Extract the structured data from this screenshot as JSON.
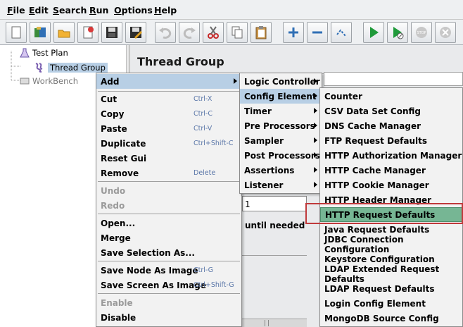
{
  "menubar": {
    "items": [
      {
        "label": "File",
        "u": "F",
        "rest": "ile"
      },
      {
        "label": "Edit",
        "u": "E",
        "rest": "dit"
      },
      {
        "label": "Search",
        "u": "S",
        "rest": "earch"
      },
      {
        "label": "Run",
        "u": "R",
        "rest": "un"
      },
      {
        "label": "Options",
        "u": "O",
        "rest": "ptions"
      },
      {
        "label": "Help",
        "u": "H",
        "rest": "elp"
      }
    ]
  },
  "toolbar": {
    "buttons": [
      "new-icon",
      "templates-icon",
      "open-icon",
      "close-icon",
      "save-icon",
      "save-as-icon",
      "undo-icon",
      "redo-icon",
      "cut-icon",
      "copy-icon",
      "paste-icon",
      "expand-icon",
      "collapse-icon",
      "toggle-icon",
      "start-icon",
      "start-no-pause-icon",
      "stop-icon",
      "shutdown-icon"
    ]
  },
  "tree": {
    "test_plan": "Test Plan",
    "thread_group": "Thread Group",
    "workbench": "WorkBench"
  },
  "panel": {
    "title": "Thread Group",
    "loop_value": "1",
    "until_needed": "until needed"
  },
  "context_menu": {
    "add": "Add",
    "cut": {
      "label": "Cut",
      "shortcut": "Ctrl-X"
    },
    "copy": {
      "label": "Copy",
      "shortcut": "Ctrl-C"
    },
    "paste": {
      "label": "Paste",
      "shortcut": "Ctrl-V"
    },
    "duplicate": {
      "label": "Duplicate",
      "shortcut": "Ctrl+Shift-C"
    },
    "reset_gui": "Reset Gui",
    "remove": {
      "label": "Remove",
      "shortcut": "Delete"
    },
    "undo": "Undo",
    "redo": "Redo",
    "open": "Open...",
    "merge": "Merge",
    "save_selection": "Save Selection As...",
    "save_node_image": {
      "label": "Save Node As Image",
      "shortcut": "Ctrl-G"
    },
    "save_screen_image": {
      "label": "Save Screen As Image",
      "shortcut": "Ctrl+Shift-G"
    },
    "enable": "Enable",
    "disable": "Disable"
  },
  "add_menu": {
    "items": [
      "Logic Controller",
      "Config Element",
      "Timer",
      "Pre Processors",
      "Sampler",
      "Post Processors",
      "Assertions",
      "Listener"
    ]
  },
  "config_menu": {
    "items": [
      "Counter",
      "CSV Data Set Config",
      "DNS Cache Manager",
      "FTP Request Defaults",
      "HTTP Authorization Manager",
      "HTTP Cache Manager",
      "HTTP Cookie Manager",
      "HTTP Header Manager",
      "HTTP Request Defaults",
      "Java Request Defaults",
      "JDBC Connection Configuration",
      "Keystore Configuration",
      "LDAP Extended Request Defaults",
      "LDAP Request Defaults",
      "Login Config Element",
      "MongoDB Source Config"
    ]
  },
  "colors": {
    "highlight": "#b8cfe5",
    "selected_green": "#76b694",
    "annotation_red": "#c0393b",
    "shortcut_blue": "#5a76a8"
  }
}
